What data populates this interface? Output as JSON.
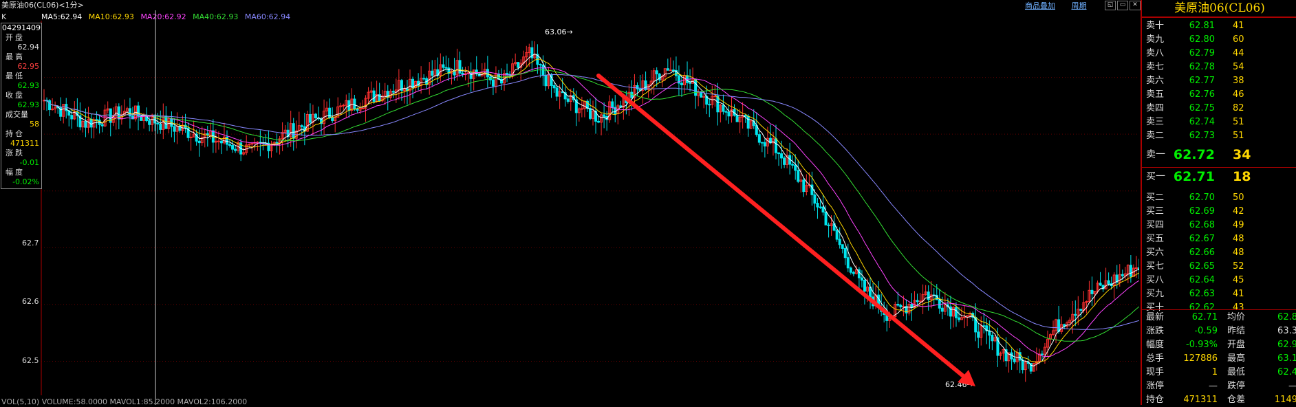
{
  "window": {
    "title": "美原油06(CL06)<1分>",
    "links": [
      "商品叠加",
      "周期"
    ]
  },
  "ma": {
    "prefix": "K",
    "items": [
      {
        "label": "MA5:62.94",
        "color": "#ffffff"
      },
      {
        "label": "MA10:62.93",
        "color": "#ffd700"
      },
      {
        "label": "MA20:62.92",
        "color": "#ff44ff"
      },
      {
        "label": "MA40:62.93",
        "color": "#33dd33"
      },
      {
        "label": "MA60:62.94",
        "color": "#8888ff"
      }
    ]
  },
  "info": {
    "date": "04291409",
    "rows": [
      {
        "label": "开盘",
        "value": "62.94",
        "color": "#dddddd"
      },
      {
        "label": "最高",
        "value": "62.95",
        "color": "#ff4040"
      },
      {
        "label": "最低",
        "value": "62.93",
        "color": "#00ee00"
      },
      {
        "label": "收盘",
        "value": "62.93",
        "color": "#00ee00"
      },
      {
        "label": "成交量",
        "value": "58",
        "color": "#ffd700"
      },
      {
        "label": "持仓",
        "value": "471311",
        "color": "#ffd700"
      },
      {
        "label": "涨跌",
        "value": "-0.01",
        "color": "#00ee00"
      },
      {
        "label": "幅度",
        "value": "-0.02%",
        "color": "#00ee00"
      }
    ]
  },
  "axis": {
    "ticks": [
      {
        "label": "62.7",
        "value": 62.7
      },
      {
        "label": "62.6",
        "value": 62.6
      },
      {
        "label": "62.5",
        "value": 62.5
      }
    ]
  },
  "chart": {
    "high_label": "63.06",
    "low_label": "62.46"
  },
  "volume": {
    "text": "VOL(5,10) VOLUME:58.0000 MAVOL1:85.2000 MAVOL2:106.2000"
  },
  "panel": {
    "title": "美原油06(CL06)",
    "asks": [
      {
        "label": "卖十",
        "price": "62.81",
        "vol": "41"
      },
      {
        "label": "卖九",
        "price": "62.80",
        "vol": "60"
      },
      {
        "label": "卖八",
        "price": "62.79",
        "vol": "44"
      },
      {
        "label": "卖七",
        "price": "62.78",
        "vol": "54"
      },
      {
        "label": "卖六",
        "price": "62.77",
        "vol": "38"
      },
      {
        "label": "卖五",
        "price": "62.76",
        "vol": "46"
      },
      {
        "label": "卖四",
        "price": "62.75",
        "vol": "82"
      },
      {
        "label": "卖三",
        "price": "62.74",
        "vol": "51"
      },
      {
        "label": "卖二",
        "price": "62.73",
        "vol": "51"
      },
      {
        "label": "卖一",
        "price": "62.72",
        "vol": "34"
      }
    ],
    "bids": [
      {
        "label": "买一",
        "price": "62.71",
        "vol": "18"
      },
      {
        "label": "买二",
        "price": "62.70",
        "vol": "50"
      },
      {
        "label": "买三",
        "price": "62.69",
        "vol": "42"
      },
      {
        "label": "买四",
        "price": "62.68",
        "vol": "49"
      },
      {
        "label": "买五",
        "price": "62.67",
        "vol": "48"
      },
      {
        "label": "买六",
        "price": "62.66",
        "vol": "48"
      },
      {
        "label": "买七",
        "price": "62.65",
        "vol": "52"
      },
      {
        "label": "买八",
        "price": "62.64",
        "vol": "45"
      },
      {
        "label": "买九",
        "price": "62.63",
        "vol": "41"
      },
      {
        "label": "买十",
        "price": "62.62",
        "vol": "43"
      }
    ],
    "stats": [
      {
        "l1": "最新",
        "v1": "62.71",
        "c1": "#00ee00",
        "l2": "均价",
        "v2": "62.8",
        "c2": "#00ee00"
      },
      {
        "l1": "涨跌",
        "v1": "-0.59",
        "c1": "#00ee00",
        "l2": "昨结",
        "v2": "63.3",
        "c2": "#dddddd"
      },
      {
        "l1": "幅度",
        "v1": "-0.93%",
        "c1": "#00ee00",
        "l2": "开盘",
        "v2": "62.9",
        "c2": "#00ee00"
      },
      {
        "l1": "总手",
        "v1": "127886",
        "c1": "#ffd700",
        "l2": "最高",
        "v2": "63.1",
        "c2": "#00ee00"
      },
      {
        "l1": "现手",
        "v1": "1",
        "c1": "#ffd700",
        "l2": "最低",
        "v2": "62.4",
        "c2": "#00ee00"
      },
      {
        "l1": "涨停",
        "v1": "—",
        "c1": "#dddddd",
        "l2": "跌停",
        "v2": "—",
        "c2": "#dddddd"
      },
      {
        "l1": "持仓",
        "v1": "471311",
        "c1": "#ffd700",
        "l2": "仓差",
        "v2": "1149",
        "c2": "#ffd700"
      }
    ]
  },
  "chart_data": {
    "type": "candlestick",
    "ylim": [
      62.44,
      63.1
    ],
    "y_ticks": [
      62.5,
      62.6,
      62.7
    ],
    "series": [
      {
        "name": "MA5",
        "color": "#ffffff"
      },
      {
        "name": "MA10",
        "color": "#ffd700"
      },
      {
        "name": "MA20",
        "color": "#ff44ff"
      },
      {
        "name": "MA40",
        "color": "#33dd33"
      },
      {
        "name": "MA60",
        "color": "#8888ff"
      }
    ],
    "close_anchors": [
      [
        0,
        62.96
      ],
      [
        15,
        62.92
      ],
      [
        30,
        62.94
      ],
      [
        55,
        62.9
      ],
      [
        75,
        62.87
      ],
      [
        95,
        62.92
      ],
      [
        110,
        62.95
      ],
      [
        130,
        62.99
      ],
      [
        150,
        63.02
      ],
      [
        165,
        62.99
      ],
      [
        175,
        63.04
      ],
      [
        185,
        62.97
      ],
      [
        200,
        62.93
      ],
      [
        215,
        62.98
      ],
      [
        225,
        63.02
      ],
      [
        235,
        62.98
      ],
      [
        250,
        62.93
      ],
      [
        265,
        62.87
      ],
      [
        280,
        62.77
      ],
      [
        295,
        62.63
      ],
      [
        305,
        62.58
      ],
      [
        318,
        62.62
      ],
      [
        332,
        62.58
      ],
      [
        345,
        62.52
      ],
      [
        355,
        62.49
      ],
      [
        365,
        62.56
      ],
      [
        378,
        62.62
      ],
      [
        395,
        62.67
      ]
    ],
    "high": 63.06,
    "low": 62.46
  }
}
